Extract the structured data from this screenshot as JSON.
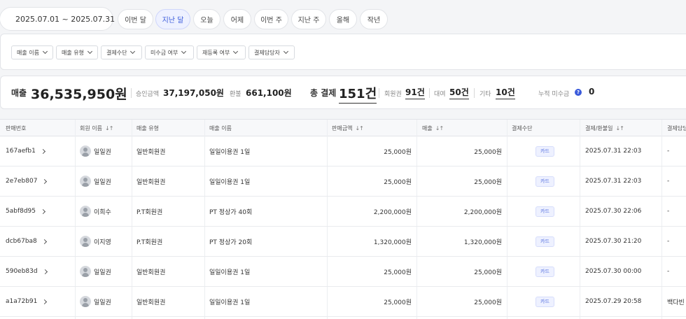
{
  "date_range": "2025.07.01 ~ 2025.07.31",
  "quick_ranges": [
    {
      "label": "이번 달",
      "active": false
    },
    {
      "label": "지난 달",
      "active": true
    },
    {
      "label": "오늘",
      "active": false
    },
    {
      "label": "어제",
      "active": false
    },
    {
      "label": "이번 주",
      "active": false
    },
    {
      "label": "지난 주",
      "active": false
    },
    {
      "label": "올해",
      "active": false
    },
    {
      "label": "작년",
      "active": false
    }
  ],
  "filters": [
    "매출 이름",
    "매출 유형",
    "결제수단",
    "미수금 여부",
    "재등록 여부",
    "결제담당자"
  ],
  "summary": {
    "sales_label": "매출",
    "sales_value": "36,535,950원",
    "approved_label": "승인금액",
    "approved_value": "37,197,050원",
    "refund_label": "환불",
    "refund_value": "661,100원",
    "total_label": "총 결제",
    "total_value": "151건",
    "member_label": "회원권",
    "member_value": "91건",
    "rental_label": "대여",
    "rental_value": "50건",
    "other_label": "기타",
    "other_value": "10건",
    "unpaid_label": "누적 미수금",
    "unpaid_help": "?",
    "unpaid_value": "0"
  },
  "table": {
    "columns": [
      "판매번호",
      "회원 이름",
      "매출 유형",
      "매출 이름",
      "판매금액",
      "매출",
      "결제수단",
      "결제/환불일",
      "결제담당"
    ],
    "sort_mark": "↓↑",
    "rows": [
      {
        "id": "167aefb1",
        "member": "일일권",
        "type": "일반회원권",
        "name": "일일이용권 1일",
        "price": "25,000원",
        "sales": "25,000원",
        "method": "카드",
        "date": "2025.07.31 22:03",
        "staff": "-"
      },
      {
        "id": "2e7eb807",
        "member": "일일권",
        "type": "일반회원권",
        "name": "일일이용권 1일",
        "price": "25,000원",
        "sales": "25,000원",
        "method": "카드",
        "date": "2025.07.31 22:03",
        "staff": "-"
      },
      {
        "id": "5abf8d95",
        "member": "이희수",
        "type": "P.T회원권",
        "name": "PT 정상가 40회",
        "price": "2,200,000원",
        "sales": "2,200,000원",
        "method": "카드",
        "date": "2025.07.30 22:06",
        "staff": "-"
      },
      {
        "id": "dcb67ba8",
        "member": "이지영",
        "type": "P.T회원권",
        "name": "PT 정상가 20회",
        "price": "1,320,000원",
        "sales": "1,320,000원",
        "method": "카드",
        "date": "2025.07.30 21:20",
        "staff": "-"
      },
      {
        "id": "590eb83d",
        "member": "일일권",
        "type": "일반회원권",
        "name": "일일이용권 1일",
        "price": "25,000원",
        "sales": "25,000원",
        "method": "카드",
        "date": "2025.07.30 00:00",
        "staff": "-"
      },
      {
        "id": "a1a72b91",
        "member": "일일권",
        "type": "일반회원권",
        "name": "일일이용권 1일",
        "price": "25,000원",
        "sales": "25,000원",
        "method": "카드",
        "date": "2025.07.29 20:58",
        "staff": "백다빈"
      }
    ]
  }
}
